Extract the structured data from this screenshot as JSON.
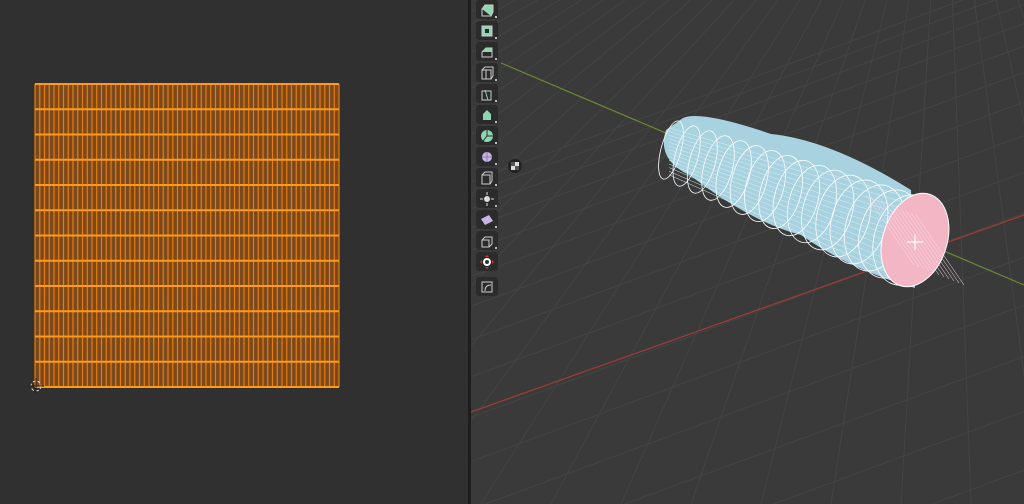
{
  "uv_editor": {
    "grid_rows": 13,
    "grid_cols": 64,
    "selection_color": "#e87d0d"
  },
  "viewport": {
    "axis_x_color": "#a33a3a",
    "axis_y_color": "#6a8a35",
    "mesh_color": "#a8d2e0",
    "selected_face_color": "#f2b6c4"
  },
  "toolbar": {
    "tools": [
      "extrude-region",
      "inset-faces",
      "bevel",
      "loop-cut",
      "knife",
      "poly-build",
      "spin",
      "smooth",
      "edge-slide",
      "shrink-fatten",
      "shear",
      "rip-region",
      "transform-gizmo",
      "measure"
    ]
  }
}
